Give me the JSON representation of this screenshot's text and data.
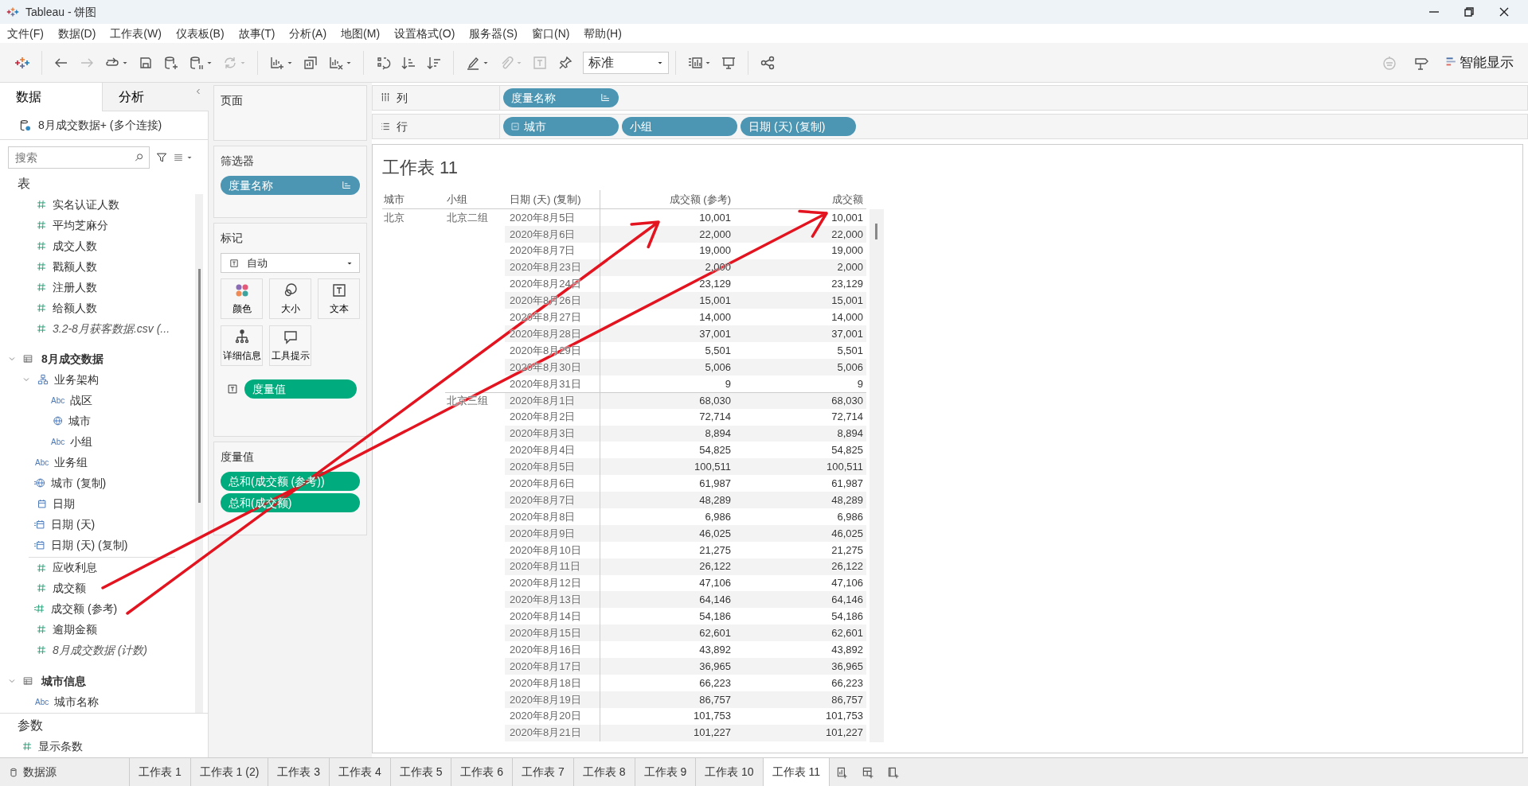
{
  "window": {
    "title": "Tableau - 饼图"
  },
  "menu": [
    "文件(F)",
    "数据(D)",
    "工作表(W)",
    "仪表板(B)",
    "故事(T)",
    "分析(A)",
    "地图(M)",
    "设置格式(O)",
    "服务器(S)",
    "窗口(N)",
    "帮助(H)"
  ],
  "toolbar": {
    "items": [
      {
        "kind": "logo"
      },
      {
        "kind": "separator"
      },
      {
        "kind": "back",
        "disabled": false,
        "dropdown": false
      },
      {
        "kind": "forward",
        "disabled": true,
        "dropdown": false
      },
      {
        "kind": "loop",
        "disabled": false,
        "dropdown": true
      },
      {
        "kind": "save",
        "disabled": false,
        "dropdown": false
      },
      {
        "kind": "add-datasource",
        "disabled": false,
        "dropdown": false
      },
      {
        "kind": "pause-datasource",
        "disabled": false,
        "dropdown": true
      },
      {
        "kind": "refresh",
        "disabled": true,
        "dropdown": true
      },
      {
        "kind": "separator"
      },
      {
        "kind": "new-sheet",
        "disabled": false,
        "dropdown": true
      },
      {
        "kind": "duplicate",
        "disabled": false,
        "dropdown": false
      },
      {
        "kind": "clear",
        "disabled": false,
        "dropdown": true
      },
      {
        "kind": "separator"
      },
      {
        "kind": "swap",
        "disabled": false,
        "dropdown": false
      },
      {
        "kind": "sort-asc",
        "disabled": false,
        "dropdown": false
      },
      {
        "kind": "sort-desc",
        "disabled": false,
        "dropdown": false
      },
      {
        "kind": "separator"
      },
      {
        "kind": "highlight",
        "disabled": false,
        "dropdown": true
      },
      {
        "kind": "attach",
        "disabled": true,
        "dropdown": true
      },
      {
        "kind": "label",
        "disabled": true,
        "dropdown": false
      },
      {
        "kind": "pin",
        "disabled": false,
        "dropdown": false
      },
      {
        "kind": "view-size"
      },
      {
        "kind": "separator"
      },
      {
        "kind": "show-me",
        "disabled": false,
        "dropdown": true
      },
      {
        "kind": "presentation",
        "disabled": false,
        "dropdown": false
      },
      {
        "kind": "separator"
      },
      {
        "kind": "share",
        "disabled": false,
        "dropdown": false
      }
    ],
    "view_size": "标准",
    "right_items": [
      {
        "kind": "bot",
        "disabled": true,
        "dropdown": false
      },
      {
        "kind": "signpost",
        "disabled": false,
        "dropdown": false
      }
    ],
    "show_me": "智能显示"
  },
  "sidebar": {
    "tabs": [
      {
        "label": "数据",
        "selected": true
      },
      {
        "label": "分析",
        "selected": false
      }
    ],
    "datasource": "8月成交数据+ (多个连接)",
    "search": {
      "placeholder": "搜索"
    },
    "section_title": "表",
    "fields": [
      {
        "label": "实名认证人数",
        "kind": "measure",
        "generated": false
      },
      {
        "label": "平均芝麻分",
        "kind": "measure",
        "generated": false
      },
      {
        "label": "成交人数",
        "kind": "measure",
        "generated": false
      },
      {
        "label": "戳额人数",
        "kind": "measure",
        "generated": false
      },
      {
        "label": "注册人数",
        "kind": "measure",
        "generated": false
      },
      {
        "label": "给额人数",
        "kind": "measure",
        "generated": false
      },
      {
        "label": "3.2-8月获客数据.csv (...",
        "kind": "measure",
        "generated": true
      }
    ],
    "tables": [
      {
        "name": "8月成交数据",
        "expanded": true,
        "children": [
          {
            "label": "业务架构",
            "kind": "hierarchy",
            "expanded": true,
            "children": [
              {
                "label": "战区",
                "kind": "dimension",
                "type_label": "Abc",
                "generated": false
              },
              {
                "label": "城市",
                "kind": "geo",
                "generated": false
              },
              {
                "label": "小组",
                "kind": "dimension",
                "type_label": "Abc",
                "generated": false
              }
            ]
          },
          {
            "label": "业务组",
            "kind": "dimension",
            "type_label": "Abc",
            "generated": false
          },
          {
            "label": "城市 (复制)",
            "kind": "geo-calc",
            "generated": false
          },
          {
            "label": "日期",
            "kind": "date",
            "generated": false
          },
          {
            "label": "日期 (天)",
            "kind": "date-calc",
            "generated": false
          },
          {
            "label": "日期 (天) (复制)",
            "kind": "date-calc",
            "generated": false
          },
          {
            "label": "应收利息",
            "kind": "measure",
            "generated": false
          },
          {
            "label": "成交额",
            "kind": "measure",
            "generated": false
          },
          {
            "label": "成交额 (参考)",
            "kind": "measure-calc",
            "generated": false
          },
          {
            "label": "逾期金额",
            "kind": "measure",
            "generated": false
          },
          {
            "label": "8月成交数据 (计数)",
            "kind": "measure",
            "generated": true
          }
        ]
      },
      {
        "name": "城市信息",
        "expanded": true,
        "children": [
          {
            "label": "城市名称",
            "kind": "dimension",
            "type_label": "Abc",
            "generated": false
          }
        ]
      }
    ],
    "parameters": {
      "title": "参数",
      "items": [
        {
          "label": "显示条数",
          "kind": "measure",
          "generated": false
        }
      ]
    }
  },
  "cards": {
    "pages": {
      "title": "页面"
    },
    "filters": {
      "title": "筛选器",
      "pills": [
        {
          "label": "度量名称",
          "kind": "discrete",
          "sorted": true
        }
      ]
    },
    "marks": {
      "title": "标记",
      "mark_type": "自动",
      "buttons": [
        {
          "label": "颜色",
          "kind": "color"
        },
        {
          "label": "大小",
          "kind": "size"
        },
        {
          "label": "文本",
          "kind": "text"
        },
        {
          "label": "详细信息",
          "kind": "detail"
        },
        {
          "label": "工具提示",
          "kind": "tooltip"
        }
      ],
      "pills": [
        {
          "label": "度量值",
          "kind": "continuous",
          "text_encoding": true
        }
      ]
    },
    "measure_values": {
      "title": "度量值",
      "pills": [
        {
          "label": "总和(成交额 (参考))",
          "kind": "continuous"
        },
        {
          "label": "总和(成交额)",
          "kind": "continuous"
        }
      ]
    }
  },
  "shelves": {
    "columns": {
      "label": "列",
      "pills": [
        {
          "label": "度量名称",
          "kind": "discrete",
          "sorted": true,
          "expanded": false
        }
      ]
    },
    "rows": {
      "label": "行",
      "pills": [
        {
          "label": "城市",
          "kind": "discrete",
          "sorted": false,
          "expanded": true
        },
        {
          "label": "小组",
          "kind": "discrete",
          "sorted": false,
          "expanded": false
        },
        {
          "label": "日期 (天) (复制)",
          "kind": "discrete",
          "sorted": false,
          "expanded": false
        }
      ]
    }
  },
  "sheet": {
    "title": "工作表 11",
    "columns": [
      "城市",
      "小组",
      "日期 (天) (复制)",
      "成交额 (参考)",
      "成交额"
    ],
    "groups": [
      {
        "city": "北京",
        "subgroups": [
          {
            "name": "北京二组",
            "rows": [
              [
                "2020年8月5日",
                "10,001",
                "10,001"
              ],
              [
                "2020年8月6日",
                "22,000",
                "22,000"
              ],
              [
                "2020年8月7日",
                "19,000",
                "19,000"
              ],
              [
                "2020年8月23日",
                "2,000",
                "2,000"
              ],
              [
                "2020年8月24日",
                "23,129",
                "23,129"
              ],
              [
                "2020年8月26日",
                "15,001",
                "15,001"
              ],
              [
                "2020年8月27日",
                "14,000",
                "14,000"
              ],
              [
                "2020年8月28日",
                "37,001",
                "37,001"
              ],
              [
                "2020年8月29日",
                "5,501",
                "5,501"
              ],
              [
                "2020年8月30日",
                "5,006",
                "5,006"
              ],
              [
                "2020年8月31日",
                "9",
                "9"
              ]
            ]
          },
          {
            "name": "北京三组",
            "rows": [
              [
                "2020年8月1日",
                "68,030",
                "68,030"
              ],
              [
                "2020年8月2日",
                "72,714",
                "72,714"
              ],
              [
                "2020年8月3日",
                "8,894",
                "8,894"
              ],
              [
                "2020年8月4日",
                "54,825",
                "54,825"
              ],
              [
                "2020年8月5日",
                "100,511",
                "100,511"
              ],
              [
                "2020年8月6日",
                "61,987",
                "61,987"
              ],
              [
                "2020年8月7日",
                "48,289",
                "48,289"
              ],
              [
                "2020年8月8日",
                "6,986",
                "6,986"
              ],
              [
                "2020年8月9日",
                "46,025",
                "46,025"
              ],
              [
                "2020年8月10日",
                "21,275",
                "21,275"
              ],
              [
                "2020年8月11日",
                "26,122",
                "26,122"
              ],
              [
                "2020年8月12日",
                "47,106",
                "47,106"
              ],
              [
                "2020年8月13日",
                "64,146",
                "64,146"
              ],
              [
                "2020年8月14日",
                "54,186",
                "54,186"
              ],
              [
                "2020年8月15日",
                "62,601",
                "62,601"
              ],
              [
                "2020年8月16日",
                "43,892",
                "43,892"
              ],
              [
                "2020年8月17日",
                "36,965",
                "36,965"
              ],
              [
                "2020年8月18日",
                "66,223",
                "66,223"
              ],
              [
                "2020年8月19日",
                "86,757",
                "86,757"
              ],
              [
                "2020年8月20日",
                "101,753",
                "101,753"
              ],
              [
                "2020年8月21日",
                "101,227",
                "101,227"
              ]
            ]
          }
        ]
      }
    ]
  },
  "bottom_tabs": {
    "datasource": "数据源",
    "sheets": [
      {
        "label": "工作表 1",
        "selected": false
      },
      {
        "label": "工作表 1 (2)",
        "selected": false
      },
      {
        "label": "工作表 3",
        "selected": false
      },
      {
        "label": "工作表 4",
        "selected": false
      },
      {
        "label": "工作表 5",
        "selected": false
      },
      {
        "label": "工作表 6",
        "selected": false
      },
      {
        "label": "工作表 7",
        "selected": false
      },
      {
        "label": "工作表 8",
        "selected": false
      },
      {
        "label": "工作表 9",
        "selected": false
      },
      {
        "label": "工作表 10",
        "selected": false
      },
      {
        "label": "工作表 11",
        "selected": true
      }
    ]
  }
}
